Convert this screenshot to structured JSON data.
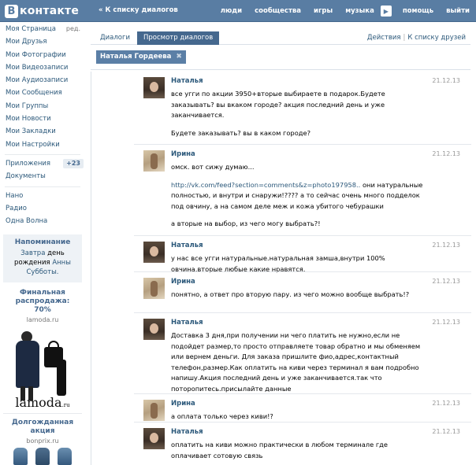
{
  "header": {
    "logo_letter": "В",
    "logo_text": "контакте",
    "back_link": "« К списку диалогов",
    "nav": [
      "люди",
      "сообщества",
      "игры",
      "музыка"
    ],
    "nav_more_icon": "play-arrow-icon",
    "nav_after": [
      "помощь",
      "выйти"
    ]
  },
  "sidebar": {
    "items": [
      {
        "label": "Моя Страница",
        "extra": "ред."
      },
      {
        "label": "Мои Друзья"
      },
      {
        "label": "Мои Фотографии"
      },
      {
        "label": "Мои Видеозаписи"
      },
      {
        "label": "Мои Аудиозаписи"
      },
      {
        "label": "Мои Сообщения"
      },
      {
        "label": "Мои Группы"
      },
      {
        "label": "Мои Новости"
      },
      {
        "label": "Мои Закладки"
      },
      {
        "label": "Мои Настройки"
      }
    ],
    "apps": {
      "label": "Приложения",
      "badge": "+23"
    },
    "docs": "Документы",
    "groups": [
      "Нано",
      "Радио",
      "Одна Волна"
    ],
    "reminder": {
      "title": "Напоминание",
      "line1": "Завтра",
      "line1_dark": "день",
      "line2_dark": "рождения",
      "line2": "Анны",
      "line3": "Субботы."
    },
    "ad1": {
      "title_line1": "Финальная",
      "title_line2": "распродажа:",
      "title_line3": "70%",
      "domain": "lamoda.ru",
      "brand": "lamoda",
      "brand_suffix": ".ru"
    },
    "ad2": {
      "title_line1": "Долгожданная",
      "title_line2": "акция",
      "domain": "bonprix.ru"
    }
  },
  "tabs": {
    "dialogs": "Диалоги",
    "view": "Просмотр диалогов",
    "actions": "Действия",
    "friends": "К списку друзей",
    "separator": "|"
  },
  "filter": {
    "name": "Наталья Гордеева",
    "close": "✖"
  },
  "messages": [
    {
      "author": "Наталья",
      "date": "21.12.13",
      "avatar": "natalia",
      "paragraphs": [
        "все угги по акции 3950+вторые выбираете в подарок.Будете заказывать? вы вкаком городе? акция последний день и уже заканчивается.",
        "Будете заказывать? вы в каком городе?"
      ]
    },
    {
      "author": "Ирина",
      "date": "21.12.13",
      "avatar": "irina",
      "paragraphs": [
        "омск. вот сижу думаю...",
        "",
        "а вторые на выбор, из чего могу выбрать?!"
      ],
      "link": "http://vk.com/feed?section=comments&z=photo197958..",
      "link_rest": " они натуральные полностью, и внутри и снаружи!???? а то сейчас очень много подделок под овчину, а на самом деле меж и кожа убитого чебурашки"
    },
    {
      "author": "Наталья",
      "date": "21.12.13",
      "avatar": "natalia",
      "paragraphs": [
        "у нас все угги натуральные.натуральная замша,внутри 100% овчина.вторые любые какие нравятся."
      ]
    },
    {
      "author": "Ирина",
      "date": "21.12.13",
      "avatar": "irina",
      "paragraphs": [
        "понятно, а ответ про вторую пару. из чего можно вообще выбрать!?"
      ]
    },
    {
      "author": "Наталья",
      "date": "21.12.13",
      "avatar": "natalia",
      "paragraphs": [
        "Доставка 3 дня,при получении ни чего платить не нужно,если не подойдет размер,то просто отправляете товар обратно и мы обменяем или вернем деньги. Для заказа пришлите фио,адрес,контактный телефон,размер.Как оплатить на киви через терминал я вам подробно напишу.Акция последний день и уже заканчивается.так что поторопитесь.присылайте данные"
      ]
    },
    {
      "author": "Ирина",
      "date": "21.12.13",
      "avatar": "irina",
      "paragraphs": [
        "а оплата только через киви!?"
      ]
    },
    {
      "author": "Наталья",
      "date": "21.12.13",
      "avatar": "natalia",
      "paragraphs": [
        "оплатить на киви можно практически в любом терминале где оплачивает сотовую связь"
      ]
    }
  ]
}
